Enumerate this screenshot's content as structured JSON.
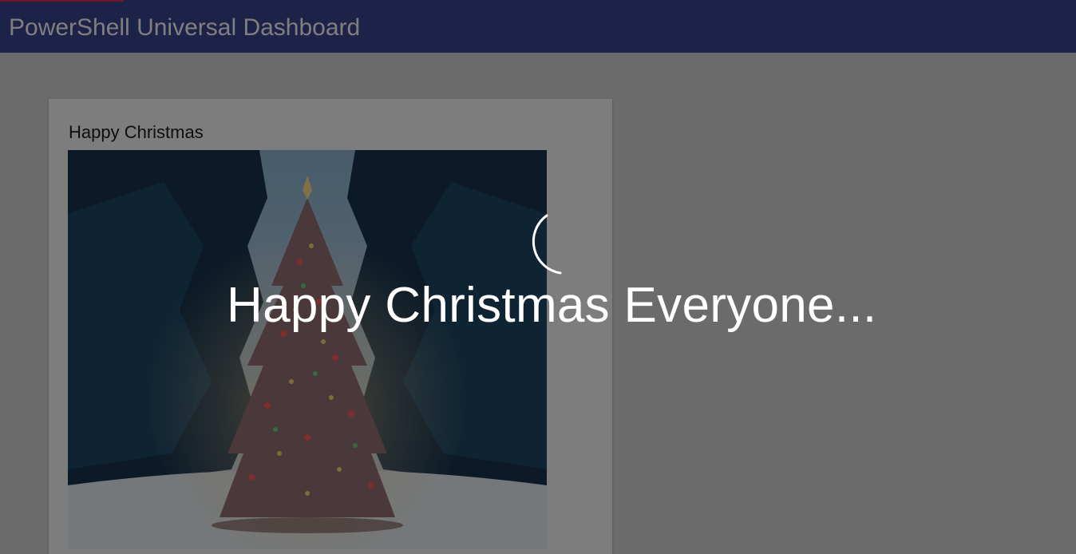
{
  "navbar": {
    "title": "PowerShell Universal Dashboard",
    "color": "#3a4591",
    "progress_color": "#e8304a"
  },
  "card": {
    "title": "Happy Christmas",
    "image": "christmas-tree-photo"
  },
  "loading_overlay": {
    "message": "Happy Christmas Everyone...",
    "spinner": "spinner-icon"
  }
}
